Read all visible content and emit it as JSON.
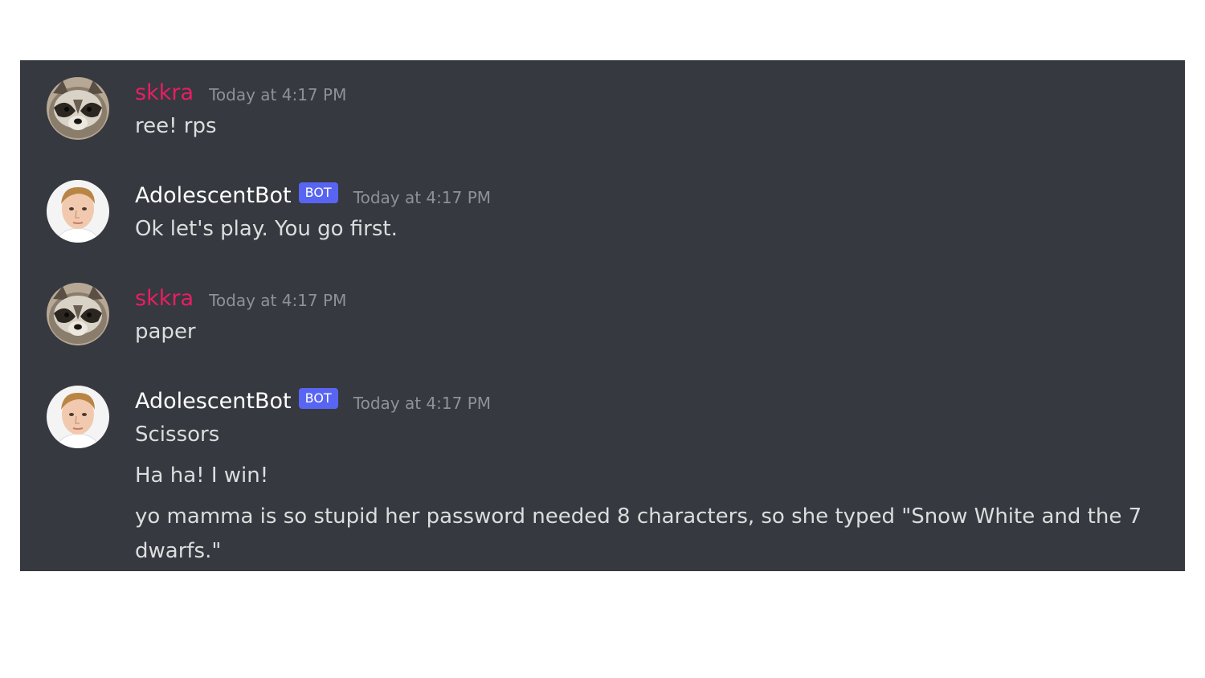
{
  "colors": {
    "background": "#36393f",
    "skkra_name": "#e91e63",
    "bot_name": "#ffffff",
    "bot_tag": "#5865f2",
    "timestamp": "#8e9297",
    "message_text": "#dcddde"
  },
  "messages": [
    {
      "author": "skkra",
      "avatar_icon": "raccoon-avatar",
      "timestamp": "Today at 4:17 PM",
      "lines": [
        "ree! rps"
      ]
    },
    {
      "author": "AdolescentBot",
      "bot_tag": "BOT",
      "avatar_icon": "boy-avatar",
      "timestamp": "Today at 4:17 PM",
      "lines": [
        "Ok let's play. You go first."
      ]
    },
    {
      "author": "skkra",
      "avatar_icon": "raccoon-avatar",
      "timestamp": "Today at 4:17 PM",
      "lines": [
        "paper"
      ]
    },
    {
      "author": "AdolescentBot",
      "bot_tag": "BOT",
      "avatar_icon": "boy-avatar",
      "timestamp": "Today at 4:17 PM",
      "lines": [
        "Scissors",
        "Ha ha! I win!",
        "yo mamma is so stupid her password needed 8 characters, so she typed \"Snow White and the 7 dwarfs.\""
      ]
    }
  ]
}
